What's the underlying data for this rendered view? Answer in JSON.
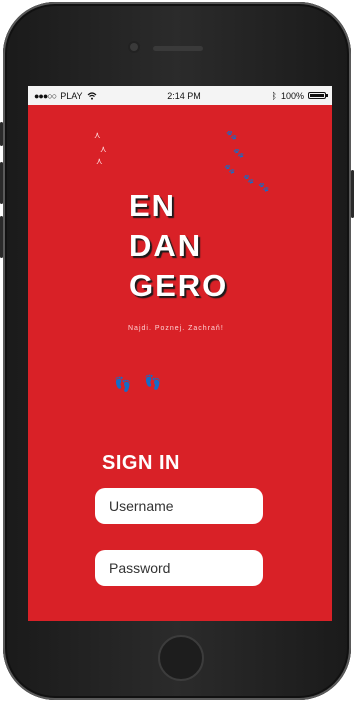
{
  "status_bar": {
    "carrier": "PLAY",
    "time": "2:14 PM",
    "battery": "100%"
  },
  "logo": {
    "line1": "EN",
    "line2": "DAN",
    "line3": "GERO",
    "tagline": "Najdi. Poznej. Zachraň!"
  },
  "login": {
    "title": "SIGN IN",
    "username_placeholder": "Username",
    "password_placeholder": "Password"
  },
  "colors": {
    "background": "#d92127",
    "text": "#ffffff",
    "field_bg": "#ffffff"
  },
  "icons": {
    "signal": "signal-dots",
    "wifi": "wifi-icon",
    "bluetooth": "bluetooth-icon",
    "battery": "battery-icon",
    "decor": "animal-tracks"
  }
}
